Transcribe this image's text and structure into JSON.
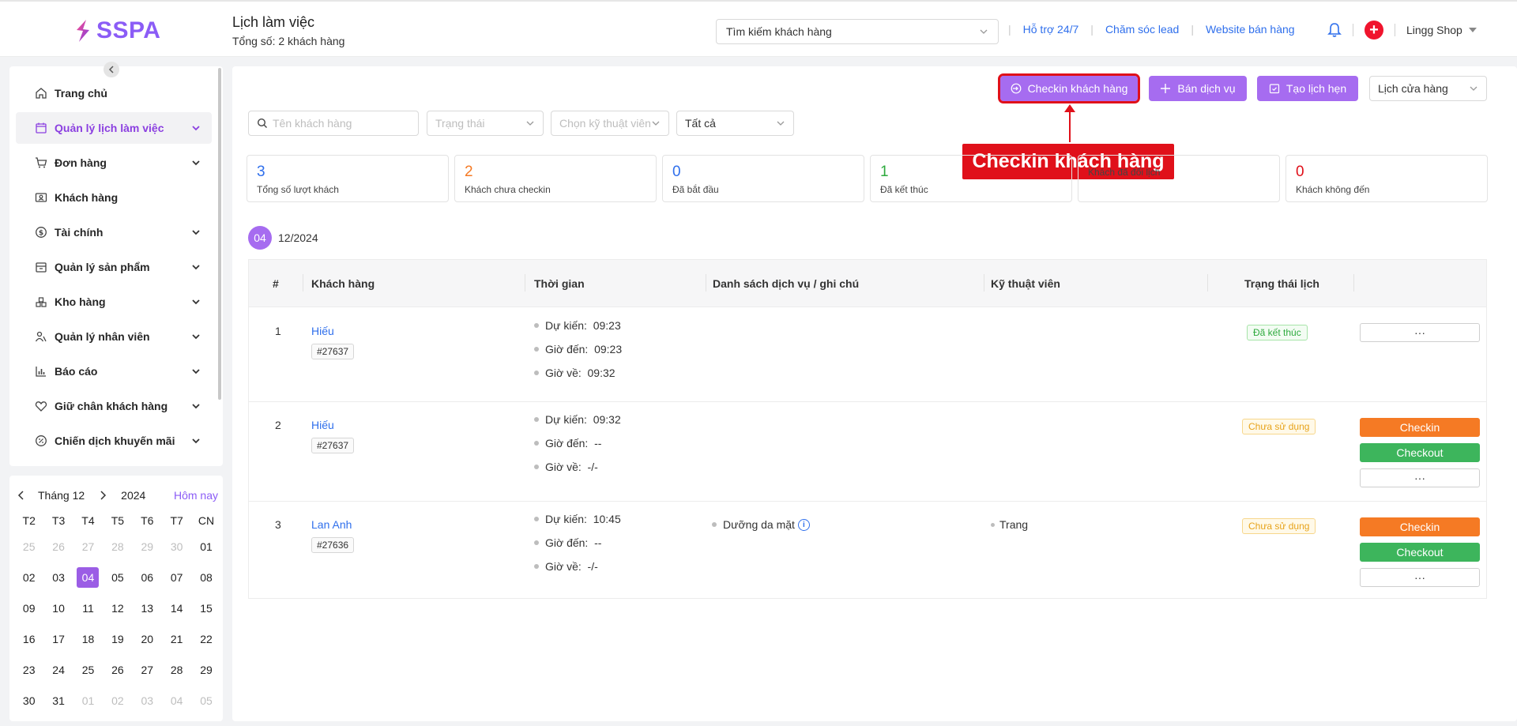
{
  "header": {
    "brand": "SSPA",
    "title": "Lịch làm việc",
    "subtitle": "Tổng số: 2 khách hàng",
    "search_placeholder": "Tìm kiếm khách hàng",
    "links": [
      "Hỗ trợ 24/7",
      "Chăm sóc lead",
      "Website bán hàng"
    ],
    "shop_name": "Lingg Shop",
    "icons": [
      "bell-icon",
      "plus-icon",
      "chevron-down-icon"
    ]
  },
  "sidebar": {
    "items": [
      {
        "label": "Trang chủ",
        "icon": "home-icon",
        "expandable": false
      },
      {
        "label": "Quản lý lịch làm việc",
        "icon": "calendar-icon",
        "expandable": true,
        "active": true
      },
      {
        "label": "Đơn hàng",
        "icon": "cart-icon",
        "expandable": true
      },
      {
        "label": "Khách hàng",
        "icon": "contact-card-icon",
        "expandable": false
      },
      {
        "label": "Tài chính",
        "icon": "dollar-icon",
        "expandable": true
      },
      {
        "label": "Quản lý sản phẩm",
        "icon": "box-icon",
        "expandable": true
      },
      {
        "label": "Kho hàng",
        "icon": "warehouse-icon",
        "expandable": true
      },
      {
        "label": "Quản lý nhân viên",
        "icon": "users-icon",
        "expandable": true
      },
      {
        "label": "Báo cáo",
        "icon": "bar-chart-icon",
        "expandable": true
      },
      {
        "label": "Giữ chân khách hàng",
        "icon": "heart-icon",
        "expandable": true
      },
      {
        "label": "Chiến dịch khuyến mãi",
        "icon": "percent-icon",
        "expandable": true
      }
    ]
  },
  "calendar": {
    "month_label": "Tháng 12",
    "year": "2024",
    "today_label": "Hôm nay",
    "weekdays": [
      "T2",
      "T3",
      "T4",
      "T5",
      "T6",
      "T7",
      "CN"
    ],
    "weeks": [
      [
        "25",
        "26",
        "27",
        "28",
        "29",
        "30",
        "01"
      ],
      [
        "02",
        "03",
        "04",
        "05",
        "06",
        "07",
        "08"
      ],
      [
        "09",
        "10",
        "11",
        "12",
        "13",
        "14",
        "15"
      ],
      [
        "16",
        "17",
        "18",
        "19",
        "20",
        "21",
        "22"
      ],
      [
        "23",
        "24",
        "25",
        "26",
        "27",
        "28",
        "29"
      ],
      [
        "30",
        "31",
        "01",
        "02",
        "03",
        "04",
        "05"
      ]
    ],
    "selected": "04"
  },
  "toolbar": {
    "checkin_label": "Checkin khách hàng",
    "sell_label": "Bán dịch vụ",
    "create_label": "Tạo lịch hẹn",
    "store_select": "Lịch cửa hàng"
  },
  "annotation": {
    "callout": "Checkin khách hàng"
  },
  "filters": {
    "name_placeholder": "Tên khách hàng",
    "status_placeholder": "Trạng thái",
    "tech_placeholder": "Chọn kỹ thuật viên",
    "scope_value": "Tất cả"
  },
  "stats": [
    {
      "value": "3",
      "label": "Tổng số lượt khách",
      "color": "#2f6fec"
    },
    {
      "value": "2",
      "label": "Khách chưa checkin",
      "color": "#f57a24"
    },
    {
      "value": "0",
      "label": "Đã bắt đầu",
      "color": "#2f6fec"
    },
    {
      "value": "1",
      "label": "Đã kết thúc",
      "color": "#2eaa3e"
    },
    {
      "value": "",
      "label": "Khách đã đổi lịch",
      "color": "#8b5cf6"
    },
    {
      "value": "0",
      "label": "Khách không đến",
      "color": "#e0101a"
    }
  ],
  "date_group": {
    "day": "04",
    "month": "12/2024"
  },
  "table": {
    "columns": [
      "#",
      "Khách hàng",
      "Thời gian",
      "Danh sách dịch vụ / ghi chú",
      "Kỹ thuật viên",
      "Trạng thái lịch"
    ],
    "rows": [
      {
        "index": "1",
        "name": "Hiếu",
        "code": "#27637",
        "expected": "Dự kiến:  09:23",
        "arrive": "Giờ đến:  09:23",
        "leave": "Giờ về:  09:32",
        "service": "",
        "tech": "",
        "status": "Đã kết thúc",
        "status_type": "done",
        "buttons": [
          "···"
        ]
      },
      {
        "index": "2",
        "name": "Hiếu",
        "code": "#27637",
        "expected": "Dự kiến:  09:32",
        "arrive": "Giờ đến:  --",
        "leave": "Giờ về:  -/-",
        "service": "",
        "tech": "",
        "status": "Chưa sử dụng",
        "status_type": "unused",
        "buttons": [
          "Checkin",
          "Checkout",
          "···"
        ]
      },
      {
        "index": "3",
        "name": "Lan Anh",
        "code": "#27636",
        "expected": "Dự kiến:  10:45",
        "arrive": "Giờ đến:  --",
        "leave": "Giờ về:  -/-",
        "service": "Dưỡng da mặt",
        "tech": "Trang",
        "status": "Chưa sử dụng",
        "status_type": "unused",
        "buttons": [
          "Checkin",
          "Checkout",
          "···"
        ]
      }
    ]
  },
  "colors": {
    "accent": "#a66cf0",
    "brand": "#8b5cf6",
    "link": "#2f6fec",
    "checkin": "#f57a24",
    "checkout": "#3db55c",
    "highlight": "#e0101a"
  }
}
